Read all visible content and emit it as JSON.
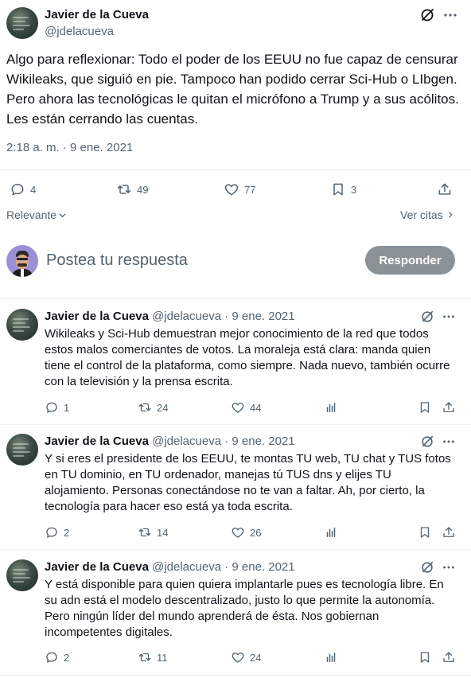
{
  "main_tweet": {
    "author_name": "Javier de la Cueva",
    "handle": "@jdelacueva",
    "text": "Algo para reflexionar: Todo el poder de los EEUU no fue capaz de censurar Wikileaks, que siguió en pie. Tampoco han podido cerrar Sci-Hub o LIbgen. Pero ahora las tecnológicas le quitan el micrófono a Trump y a sus acólitos. Les están cerrando las cuentas.",
    "timestamp": "2:18 a. m. · 9 ene. 2021",
    "replies": "4",
    "retweets": "49",
    "likes": "77",
    "bookmarks": "3"
  },
  "sort": {
    "label": "Relevante",
    "quotes_link": "Ver citas"
  },
  "composer": {
    "placeholder": "Postea tu respuesta",
    "button": "Responder"
  },
  "replies": [
    {
      "author_name": "Javier de la Cueva",
      "handle_date": "@jdelacueva · 9 ene. 2021",
      "text": "Wikileaks y Sci-Hub demuestran mejor conocimiento de la red que todos estos malos comerciantes de votos. La moraleja está clara: manda quien tiene el control de la plataforma, como siempre. Nada nuevo, también ocurre con la televisión y la prensa escrita.",
      "replies": "1",
      "retweets": "24",
      "likes": "44"
    },
    {
      "author_name": "Javier de la Cueva",
      "handle_date": "@jdelacueva · 9 ene. 2021",
      "text": "Y si eres el presidente de los EEUU, te montas TU web, TU chat y TUS fotos en TU dominio, en TU ordenador, manejas tú TUS dns y elijes TU alojamiento. Personas conectándose no te van a faltar. Ah, por cierto, la tecnología para hacer eso está ya toda escrita.",
      "replies": "2",
      "retweets": "14",
      "likes": "26"
    },
    {
      "author_name": "Javier de la Cueva",
      "handle_date": "@jdelacueva · 9 ene. 2021",
      "text": "Y está disponible para quien quiera implantarle pues es tecnología libre. En su adn está el modelo descentralizado, justo lo que permite la autonomía. Pero ningún líder del mundo aprenderá de ésta. Nos gobiernan incompetentes digitales.",
      "replies": "2",
      "retweets": "11",
      "likes": "24"
    }
  ],
  "icons": {
    "reply": "speech-bubble-icon",
    "retweet": "retweet-arrows-icon",
    "like": "heart-icon",
    "bookmark": "bookmark-icon",
    "share": "share-upload-icon",
    "views": "bar-chart-icon",
    "grok": "grok-slash-circle-icon",
    "more": "more-dots-icon"
  },
  "colors": {
    "text": "#0f1419",
    "muted": "#536471",
    "divider": "#eff3f4",
    "button": "#8b9297"
  }
}
